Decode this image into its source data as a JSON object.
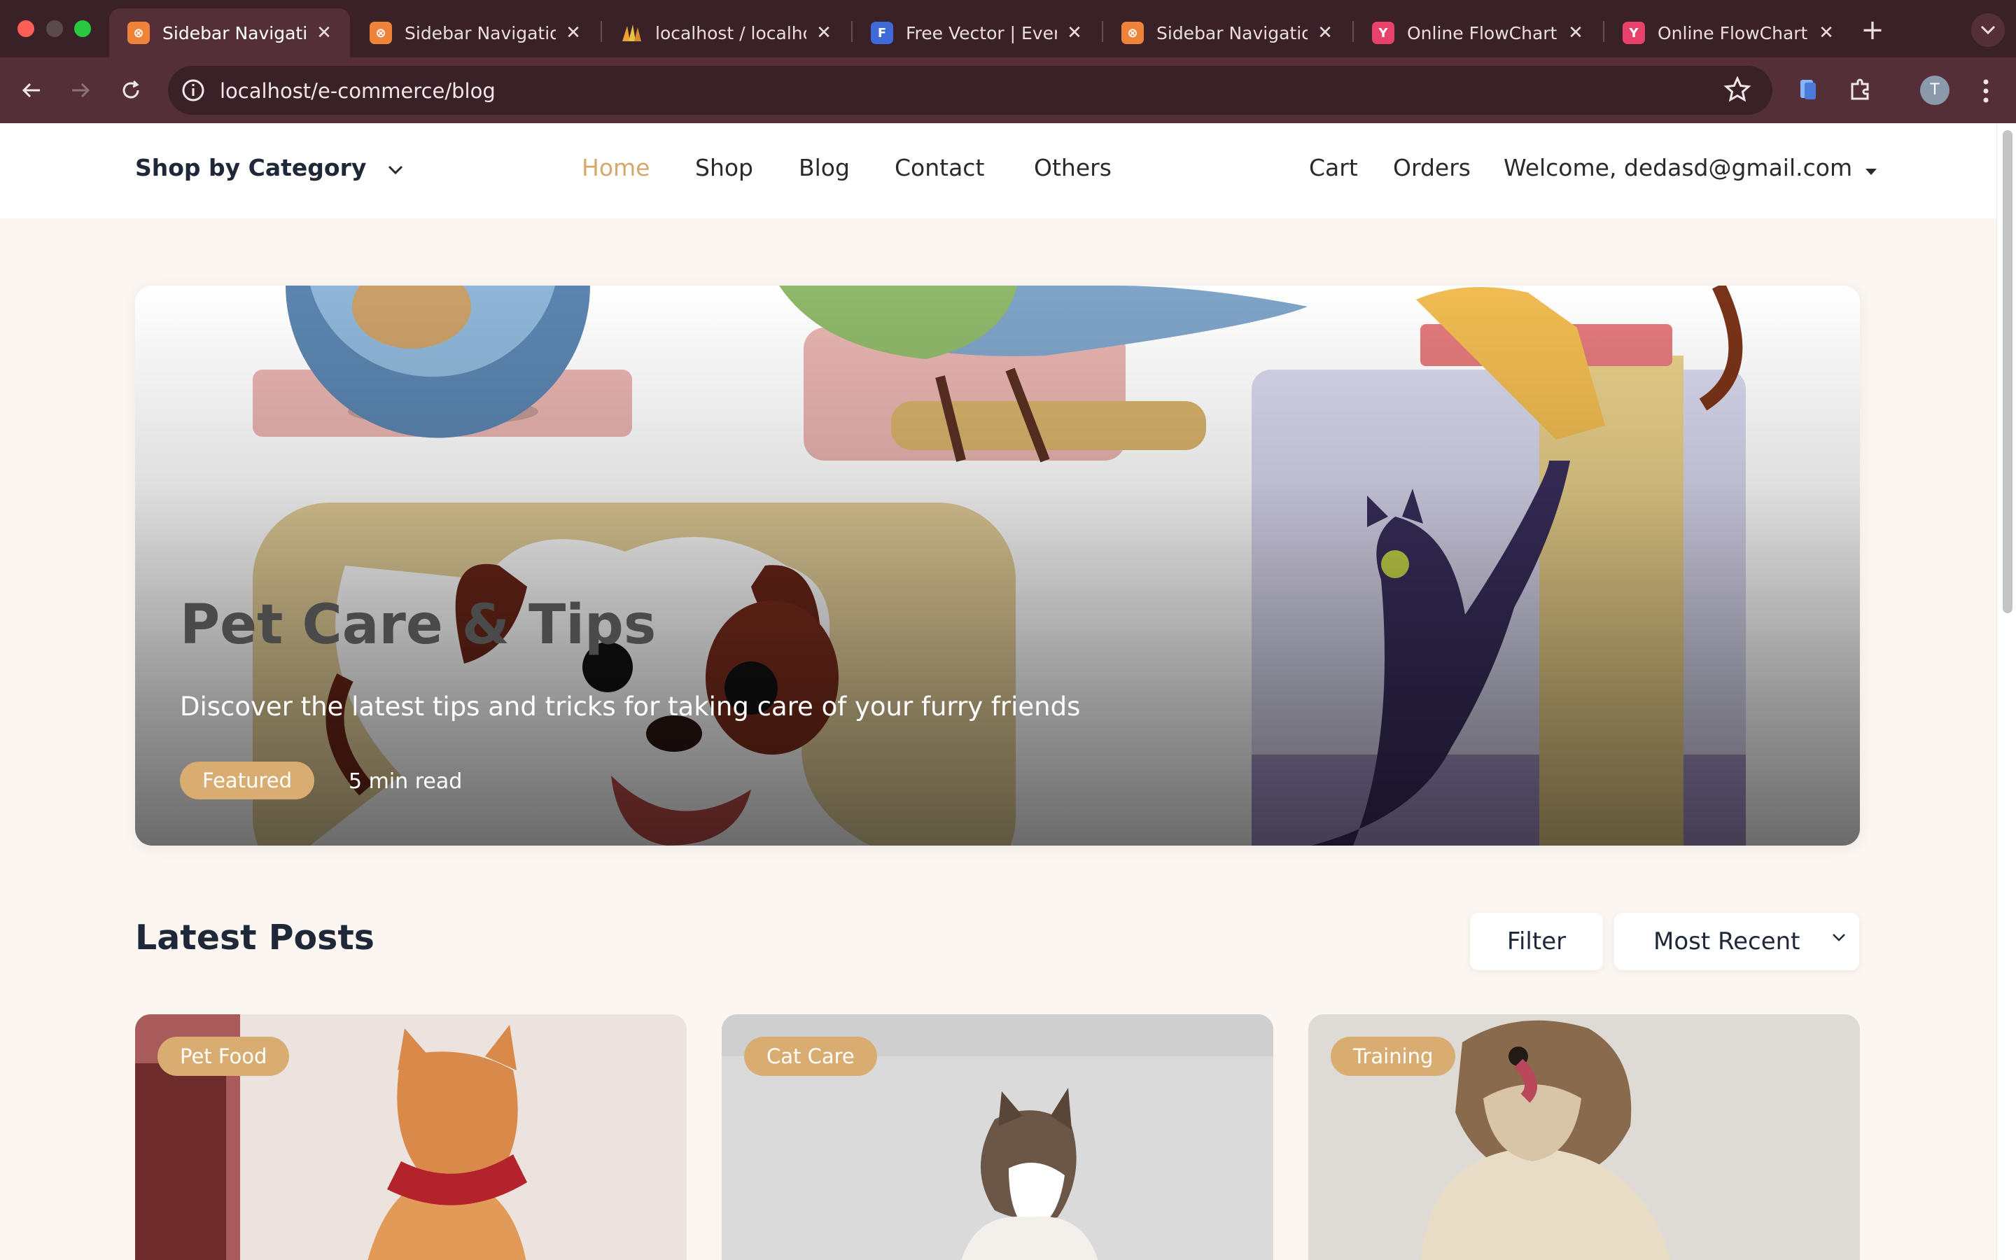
{
  "browser": {
    "tabs": [
      {
        "title": "Sidebar Navigation",
        "favicon": "xampp-icon",
        "active": true
      },
      {
        "title": "Sidebar Navigation",
        "favicon": "xampp-icon",
        "active": false
      },
      {
        "title": "localhost / localhos",
        "favicon": "phpmyadmin-icon",
        "active": false
      },
      {
        "title": "Free Vector | Every",
        "favicon": "freepik-icon",
        "active": false
      },
      {
        "title": "Sidebar Navigation",
        "favicon": "xampp-icon",
        "active": false
      },
      {
        "title": "Online FlowChart &",
        "favicon": "flowchart-icon",
        "active": false
      },
      {
        "title": "Online FlowChart &",
        "favicon": "flowchart-icon",
        "active": false
      }
    ],
    "url": "localhost/e-commerce/blog",
    "profile_initial": "T"
  },
  "site_nav": {
    "category_menu": "Shop by Category",
    "links": [
      "Home",
      "Shop",
      "Blog",
      "Contact",
      "Others"
    ],
    "active_link": "Home",
    "cart": "Cart",
    "orders": "Orders",
    "welcome": "Welcome, dedasd@gmail.com"
  },
  "hero": {
    "title": "Pet Care & Tips",
    "subtitle": "Discover the latest tips and tricks for taking care of your furry friends",
    "badge": "Featured",
    "read_time": "5 min read"
  },
  "latest": {
    "title": "Latest Posts",
    "filter_label": "Filter",
    "sort_label": "Most Recent",
    "cards": [
      {
        "tag": "Pet Food"
      },
      {
        "tag": "Cat Care"
      },
      {
        "tag": "Training"
      }
    ]
  },
  "colors": {
    "accent": "#d9ad72",
    "active_nav": "#d6a86c",
    "page_bg": "#fbf6f2",
    "chrome": "#3a2127"
  }
}
